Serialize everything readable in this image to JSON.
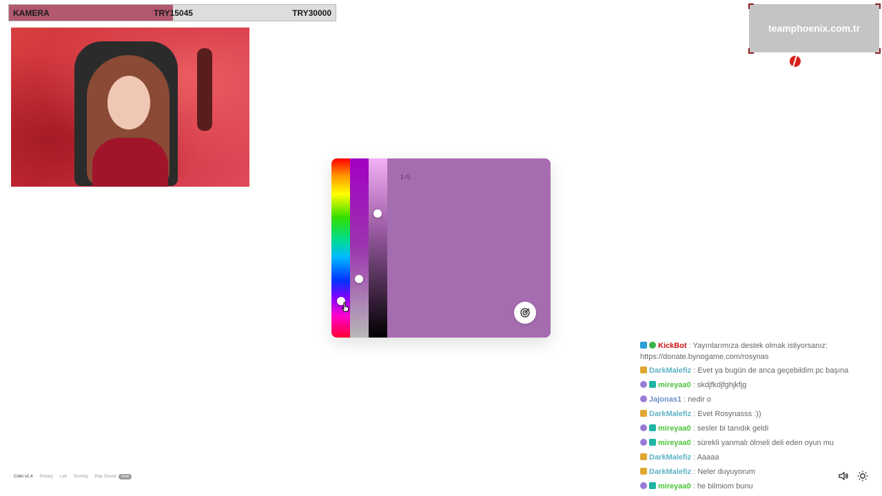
{
  "goal": {
    "title": "KAMERA",
    "current": "TRY15045",
    "target": "TRY30000",
    "progress": 0.5015,
    "fill_color": "#b2596f"
  },
  "sponsor": {
    "text": "teamphoenix.com.tr"
  },
  "color_game": {
    "counter": "1/5",
    "target_color": "#a56db0",
    "hue_position": 0.81,
    "saturation_position": 0.68,
    "lightness_position": 0.3
  },
  "footer": {
    "version": "Color v1.4",
    "links": [
      "Privacy",
      "Lab",
      "Scoring",
      "Play Sound"
    ],
    "badge": "new"
  },
  "chat": {
    "messages": [
      {
        "user": "KickBot",
        "user_color": "#cc1111",
        "text": "Yayınlarımıza destek olmak istiyorsanız:",
        "continuation": "https://donate.bynogame.com/rosynas",
        "badges": [
          "bot-badge",
          "verified-badge"
        ]
      },
      {
        "user": "DarkMalefiz",
        "user_color": "#5fb3c6",
        "text": "Evet ya bugün de anca geçebildim pc başına",
        "badges": [
          "founder-badge"
        ]
      },
      {
        "user": "mireyaa0",
        "user_color": "#4cc43a",
        "text": "skdjfkdjfghjkfjg",
        "badges": [
          "gift-badge",
          "sub-badge"
        ]
      },
      {
        "user": "Jajonas1",
        "user_color": "#6b8ec9",
        "text": "nedir o",
        "badges": [
          "gift-badge"
        ]
      },
      {
        "user": "DarkMalefiz",
        "user_color": "#5fb3c6",
        "text": "Evet Rosynasss :))",
        "badges": [
          "founder-badge"
        ]
      },
      {
        "user": "mireyaa0",
        "user_color": "#4cc43a",
        "text": "sesler bi tanıdık geldi",
        "badges": [
          "gift-badge",
          "sub-badge"
        ]
      },
      {
        "user": "mireyaa0",
        "user_color": "#4cc43a",
        "text": "sürekli yanmalı ölmeli deli eden oyun mu",
        "badges": [
          "gift-badge",
          "sub-badge"
        ]
      },
      {
        "user": "DarkMalefiz",
        "user_color": "#5fb3c6",
        "text": "Aaaaa",
        "badges": [
          "founder-badge"
        ]
      },
      {
        "user": "DarkMalefiz",
        "user_color": "#5fb3c6",
        "text": "Neler duyuyorum",
        "badges": [
          "founder-badge"
        ]
      },
      {
        "user": "mireyaa0",
        "user_color": "#4cc43a",
        "text": "he bilmiom bunu",
        "badges": [
          "gift-badge",
          "sub-badge"
        ]
      }
    ]
  },
  "toolbar": {
    "icons": [
      "volume-icon",
      "brightness-icon"
    ]
  }
}
